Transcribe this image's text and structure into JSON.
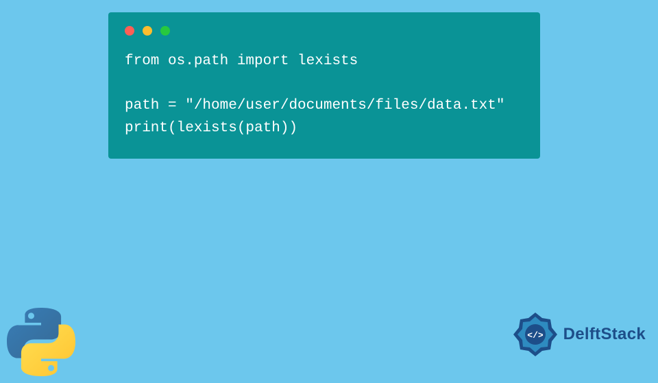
{
  "code": {
    "line1": "from os.path import lexists",
    "blank": "",
    "line2": "path = \"/home/user/documents/files/data.txt\"",
    "line3": "print(lexists(path))"
  },
  "brand": {
    "name": "DelftStack"
  },
  "colors": {
    "background": "#6cc7ed",
    "card": "#0a9396",
    "dot_red": "#ff5f56",
    "dot_yellow": "#ffbd2e",
    "dot_green": "#27c93f",
    "brand_blue": "#1d4e89"
  }
}
